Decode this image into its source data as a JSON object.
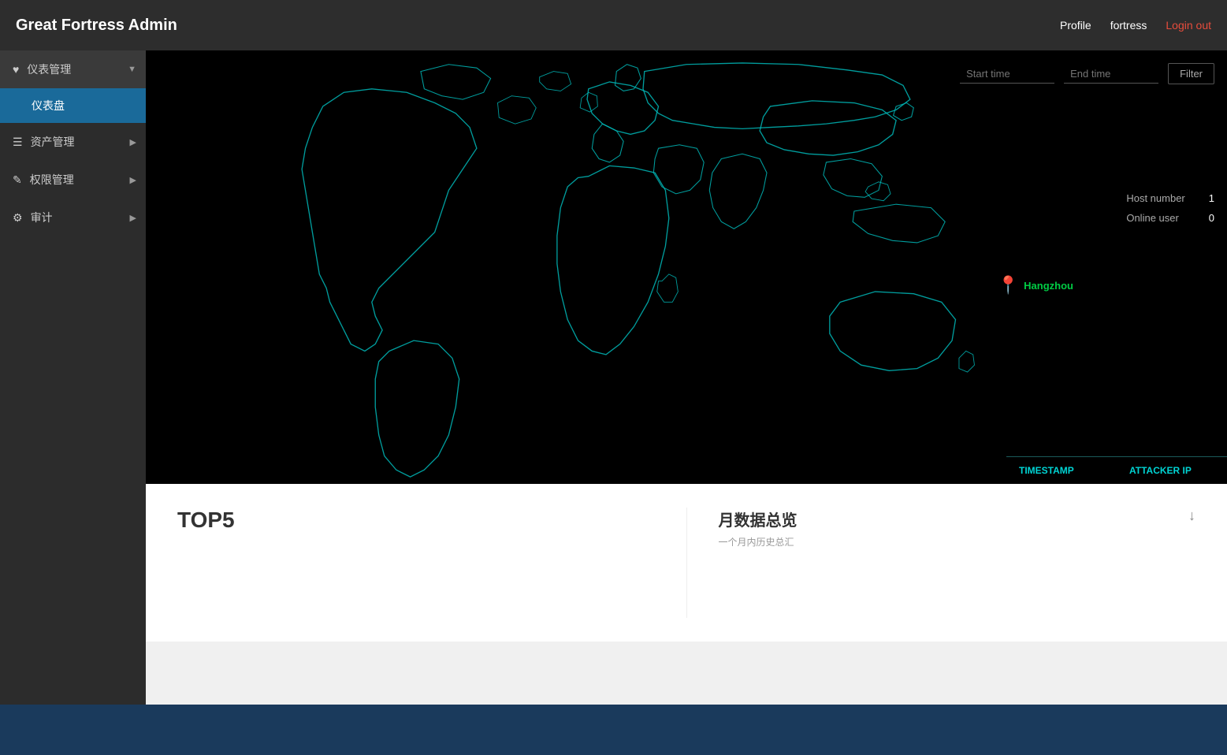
{
  "navbar": {
    "brand": "Great Fortress Admin",
    "links": {
      "profile": "Profile",
      "fortress": "fortress",
      "logout": "Login out"
    }
  },
  "sidebar": {
    "items": [
      {
        "id": "dashboard-manage",
        "label": "仪表管理",
        "icon": "heart",
        "has_arrow": true,
        "expanded": true,
        "children": [
          {
            "id": "dashboard",
            "label": "仪表盘",
            "active": true
          }
        ]
      },
      {
        "id": "asset-manage",
        "label": "资产管理",
        "icon": "list",
        "has_arrow": true,
        "expanded": false,
        "children": []
      },
      {
        "id": "permission-manage",
        "label": "权限管理",
        "icon": "pencil",
        "has_arrow": true,
        "expanded": false,
        "children": []
      },
      {
        "id": "audit",
        "label": "审计",
        "icon": "gear",
        "has_arrow": true,
        "expanded": false,
        "children": []
      }
    ]
  },
  "map": {
    "start_time_placeholder": "Start time",
    "end_time_placeholder": "End time",
    "filter_label": "Filter",
    "host_number_label": "Host number",
    "host_number_value": "1",
    "online_user_label": "Online user",
    "online_user_value": "0",
    "location_name": "Hangzhou",
    "table_cols": [
      "TIMESTAMP",
      "ATTACKER IP"
    ]
  },
  "bottom": {
    "top5_title": "TOP5",
    "monthly_title": "月数据总览",
    "monthly_subtitle": "一个月内历史总汇",
    "download_icon": "↓"
  }
}
